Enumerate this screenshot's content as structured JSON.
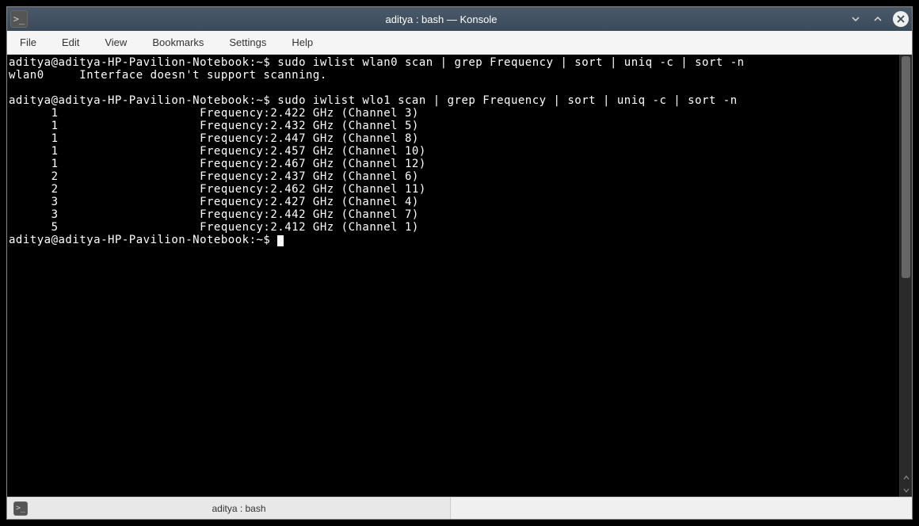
{
  "window": {
    "title": "aditya : bash — Konsole",
    "app_icon": ">_"
  },
  "menubar": {
    "items": [
      "File",
      "Edit",
      "View",
      "Bookmarks",
      "Settings",
      "Help"
    ]
  },
  "terminal": {
    "prompt": "aditya@aditya-HP-Pavilion-Notebook:~$ ",
    "history": [
      {
        "prompt": "aditya@aditya-HP-Pavilion-Notebook:~$ ",
        "cmd": "sudo iwlist wlan0 scan | grep Frequency | sort | uniq -c | sort -n"
      },
      {
        "output": "wlan0     Interface doesn't support scanning."
      },
      {
        "output": ""
      },
      {
        "prompt": "aditya@aditya-HP-Pavilion-Notebook:~$ ",
        "cmd": "sudo iwlist wlo1 scan | grep Frequency | sort | uniq -c | sort -n"
      },
      {
        "output": "      1                    Frequency:2.422 GHz (Channel 3)"
      },
      {
        "output": "      1                    Frequency:2.432 GHz (Channel 5)"
      },
      {
        "output": "      1                    Frequency:2.447 GHz (Channel 8)"
      },
      {
        "output": "      1                    Frequency:2.457 GHz (Channel 10)"
      },
      {
        "output": "      1                    Frequency:2.467 GHz (Channel 12)"
      },
      {
        "output": "      2                    Frequency:2.437 GHz (Channel 6)"
      },
      {
        "output": "      2                    Frequency:2.462 GHz (Channel 11)"
      },
      {
        "output": "      3                    Frequency:2.427 GHz (Channel 4)"
      },
      {
        "output": "      3                    Frequency:2.442 GHz (Channel 7)"
      },
      {
        "output": "      5                    Frequency:2.412 GHz (Channel 1)"
      }
    ],
    "current_prompt": "aditya@aditya-HP-Pavilion-Notebook:~$ "
  },
  "tabs": [
    {
      "label": "aditya : bash",
      "icon": ">_"
    }
  ]
}
